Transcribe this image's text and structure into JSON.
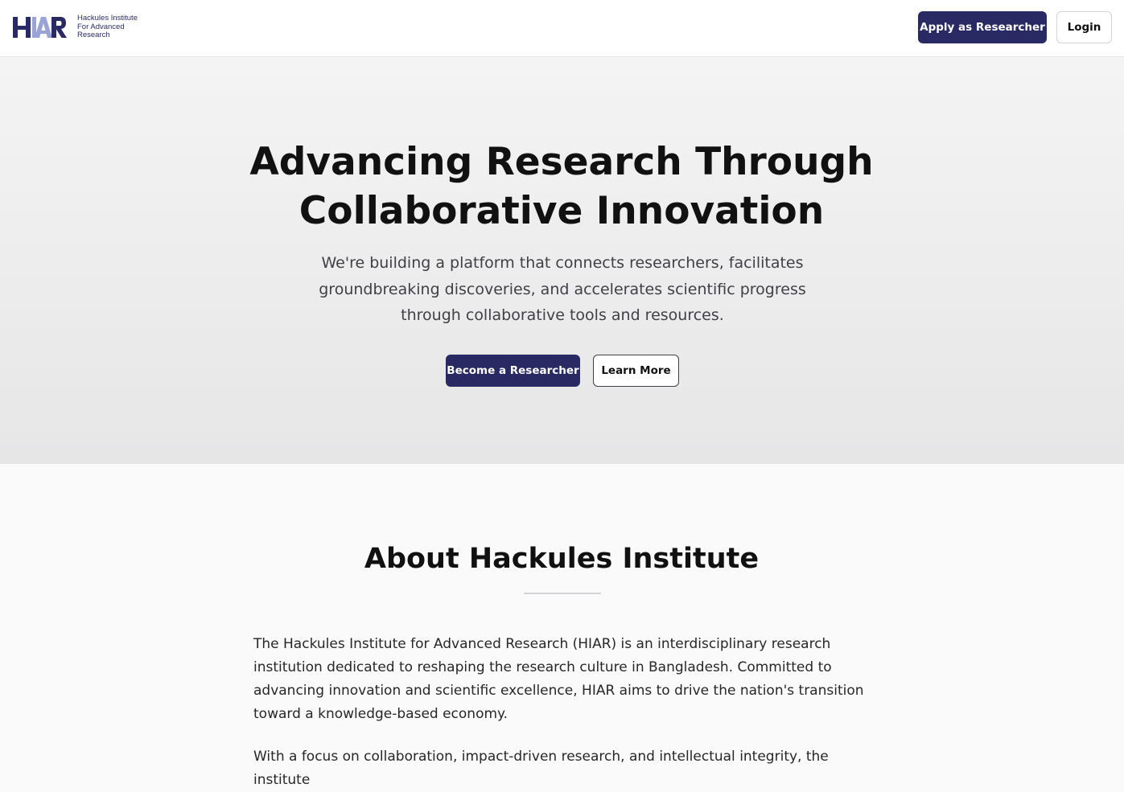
{
  "header": {
    "logo_mark": "HIAR",
    "logo_lines": [
      "Hackules Institute",
      "For Advanced",
      "Research"
    ],
    "apply_label": "Apply as Researcher",
    "login_label": "Login"
  },
  "hero": {
    "title": "Advancing Research Through Collaborative Innovation",
    "subtitle": "We're building a platform that connects researchers, facilitates groundbreaking discoveries, and accelerates scientific progress through collaborative tools and resources.",
    "primary_cta": "Become a Researcher",
    "secondary_cta": "Learn More"
  },
  "about": {
    "title": "About Hackules Institute",
    "paragraphs": [
      "The Hackules Institute for Advanced Research (HIAR) is an interdisciplinary research institution dedicated to reshaping the research culture in Bangladesh. Committed to advancing innovation and scientific excellence, HIAR aims to drive the nation's transition toward a knowledge-based economy.",
      "With a focus on collaboration, impact-driven research, and intellectual integrity, the institute"
    ]
  },
  "colors": {
    "brand": "#292a63",
    "logo_accent": "#9aa3d6"
  }
}
